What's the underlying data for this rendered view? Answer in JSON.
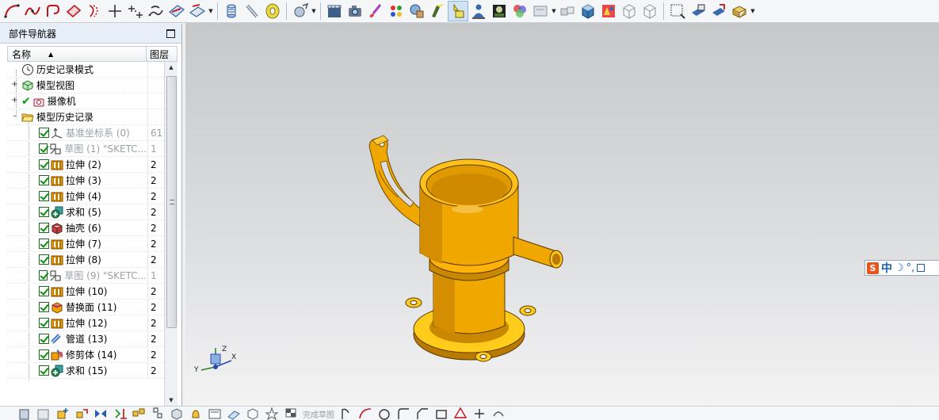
{
  "navigator": {
    "title": "部件导航器",
    "columns": {
      "name": "名称",
      "layer": "图层"
    },
    "rows": [
      {
        "label": "历史记录模式",
        "layer": "",
        "icon": "clock-icon",
        "indent": 1,
        "checked": false,
        "expander": "",
        "dim": false
      },
      {
        "label": "模型视图",
        "layer": "",
        "icon": "model-views-icon",
        "indent": 1,
        "checked": false,
        "expander": "+",
        "dim": false
      },
      {
        "label": "摄像机",
        "layer": "",
        "icon": "camera-icon",
        "indent": 1,
        "checked": true,
        "expander": "+",
        "dim": false
      },
      {
        "label": "模型历史记录",
        "layer": "",
        "icon": "folder-open-icon",
        "indent": 1,
        "checked": false,
        "expander": "-",
        "dim": false
      },
      {
        "label": "基准坐标系 (0)",
        "layer": "61",
        "icon": "datum-csys-icon",
        "indent": 2,
        "checked": true,
        "expander": "",
        "dim": true
      },
      {
        "label": "草图 (1) \"SKETC...",
        "layer": "1",
        "icon": "sketch-icon",
        "indent": 2,
        "checked": true,
        "expander": "",
        "dim": true
      },
      {
        "label": "拉伸 (2)",
        "layer": "2",
        "icon": "extrude-icon",
        "indent": 2,
        "checked": true,
        "expander": "",
        "dim": false
      },
      {
        "label": "拉伸 (3)",
        "layer": "2",
        "icon": "extrude-icon",
        "indent": 2,
        "checked": true,
        "expander": "",
        "dim": false
      },
      {
        "label": "拉伸 (4)",
        "layer": "2",
        "icon": "extrude-icon",
        "indent": 2,
        "checked": true,
        "expander": "",
        "dim": false
      },
      {
        "label": "求和 (5)",
        "layer": "2",
        "icon": "unite-icon",
        "indent": 2,
        "checked": true,
        "expander": "",
        "dim": false
      },
      {
        "label": "抽壳 (6)",
        "layer": "2",
        "icon": "shell-icon",
        "indent": 2,
        "checked": true,
        "expander": "",
        "dim": false
      },
      {
        "label": "拉伸 (7)",
        "layer": "2",
        "icon": "extrude-icon",
        "indent": 2,
        "checked": true,
        "expander": "",
        "dim": false
      },
      {
        "label": "拉伸 (8)",
        "layer": "2",
        "icon": "extrude-icon",
        "indent": 2,
        "checked": true,
        "expander": "",
        "dim": false
      },
      {
        "label": "草图 (9) \"SKETC...",
        "layer": "1",
        "icon": "sketch-icon",
        "indent": 2,
        "checked": true,
        "expander": "",
        "dim": true
      },
      {
        "label": "拉伸 (10)",
        "layer": "2",
        "icon": "extrude-icon",
        "indent": 2,
        "checked": true,
        "expander": "",
        "dim": false
      },
      {
        "label": "替换面 (11)",
        "layer": "2",
        "icon": "replace-face-icon",
        "indent": 2,
        "checked": true,
        "expander": "",
        "dim": false
      },
      {
        "label": "拉伸 (12)",
        "layer": "2",
        "icon": "extrude-icon",
        "indent": 2,
        "checked": true,
        "expander": "",
        "dim": false
      },
      {
        "label": "管道 (13)",
        "layer": "2",
        "icon": "tube-icon",
        "indent": 2,
        "checked": true,
        "expander": "",
        "dim": false
      },
      {
        "label": "修剪体 (14)",
        "layer": "2",
        "icon": "trim-body-icon",
        "indent": 2,
        "checked": true,
        "expander": "",
        "dim": false
      },
      {
        "label": "求和 (15)",
        "layer": "2",
        "icon": "unite-icon",
        "indent": 2,
        "checked": true,
        "expander": "",
        "dim": false
      }
    ]
  },
  "triad": {
    "x": "X",
    "y": "Y",
    "z": "Z"
  },
  "ime": {
    "logo": "S",
    "mode": "中",
    "moon": "☽",
    "punct": "°,"
  },
  "bottom_toolbar": {
    "faded_text": "完成草图"
  },
  "colors": {
    "model": "#f0a800",
    "model_dark": "#b87a00",
    "viewport_top": "#c6c8ca",
    "viewport_bottom": "#f3f3f4",
    "nav_header": "#e6eef7"
  }
}
